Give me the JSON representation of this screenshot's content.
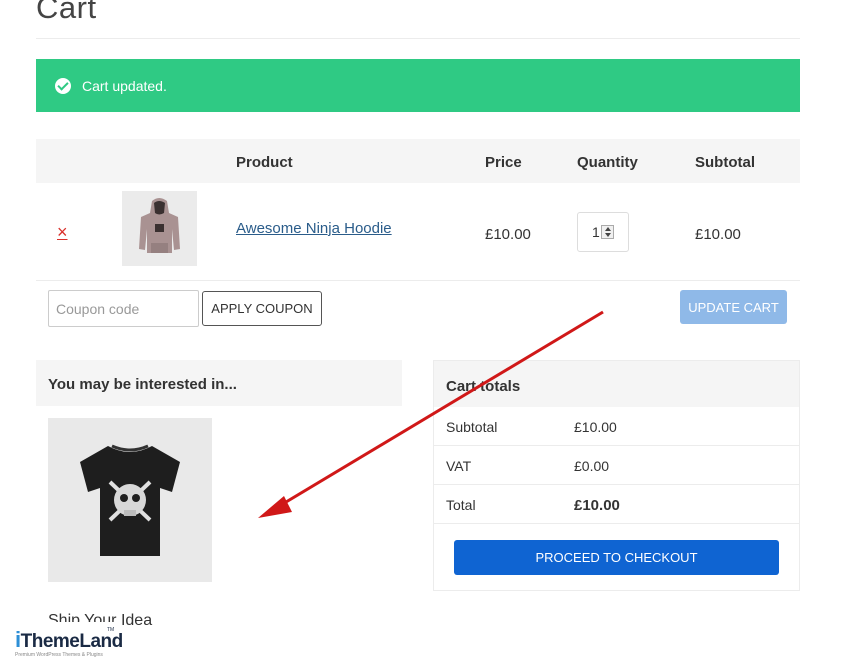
{
  "page": {
    "title": "Cart"
  },
  "notice": {
    "text": "Cart updated."
  },
  "cart_table": {
    "headers": {
      "product": "Product",
      "price": "Price",
      "quantity": "Quantity",
      "subtotal": "Subtotal"
    },
    "rows": [
      {
        "remove": "×",
        "product": "Awesome Ninja Hoodie",
        "price": "£10.00",
        "quantity": "1",
        "subtotal": "£10.00"
      }
    ]
  },
  "actions": {
    "coupon_placeholder": "Coupon code",
    "apply_label": "APPLY COUPON",
    "update_label": "UPDATE CART"
  },
  "cross_sells": {
    "heading": "You may be interested in...",
    "product_title": "Ship Your Idea"
  },
  "cart_totals": {
    "heading": "Cart totals",
    "rows": [
      {
        "label": "Subtotal",
        "value": "£10.00"
      },
      {
        "label": "VAT",
        "value": "£0.00"
      },
      {
        "label": "Total",
        "value": "£10.00"
      }
    ],
    "checkout_label": "PROCEED TO CHECKOUT"
  },
  "logo": {
    "name_i": "i",
    "name_rest": "ThemeLand",
    "tm": "TM",
    "tagline": "Premium WordPress Themes & Plugins"
  },
  "colors": {
    "notice": "#2fca84",
    "checkout": "#0f64d2",
    "update": "#8fb9e8",
    "arrow": "#d01818",
    "remove": "#d9302b",
    "link": "#2a5c8a"
  },
  "icons": {
    "notice": "check-circle-icon",
    "remove": "remove-x-icon",
    "quantity": "spinner-arrows-icon",
    "annotation": "red-arrow-icon"
  }
}
